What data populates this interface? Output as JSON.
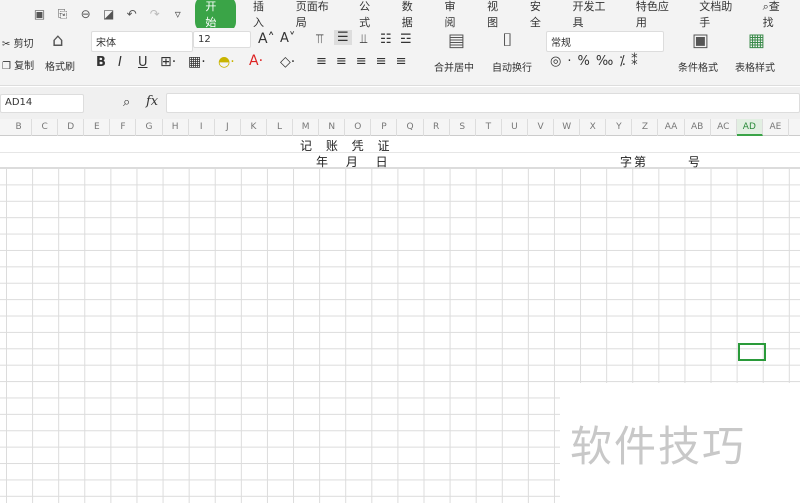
{
  "menubar": {
    "tabs": [
      "开始",
      "插入",
      "页面布局",
      "公式",
      "数据",
      "审阅",
      "视图",
      "安全",
      "开发工具",
      "特色应用",
      "文档助手"
    ],
    "search": "查找"
  },
  "ribbon": {
    "cut": "剪切",
    "copy": "复制",
    "format_painter": "格式刷",
    "font": "宋体",
    "size": "12",
    "merge": "合并居中",
    "wrap": "自动换行",
    "number_format": "常规",
    "cond_format": "条件格式",
    "table_style": "表格样式"
  },
  "formula_bar": {
    "cell_ref": "AD14",
    "fx": "fx",
    "value": ""
  },
  "columns": [
    "B",
    "C",
    "D",
    "E",
    "F",
    "G",
    "H",
    "I",
    "J",
    "K",
    "L",
    "M",
    "N",
    "O",
    "P",
    "Q",
    "R",
    "S",
    "T",
    "U",
    "V",
    "W",
    "X",
    "Y",
    "Z",
    "AA",
    "AB",
    "AC",
    "AD",
    "AE"
  ],
  "selected_column": "AD",
  "sheet": {
    "title": "记 账 凭 证",
    "date": "年 月 日",
    "zi_di": "字第",
    "hao": "号"
  },
  "watermark": "软件技巧"
}
